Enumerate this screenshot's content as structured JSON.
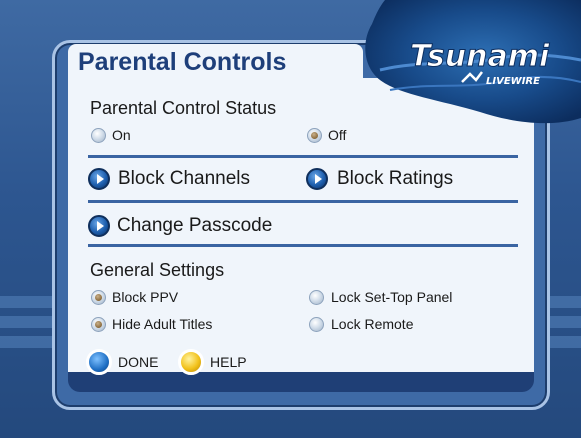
{
  "screen": {
    "title": "Parental Controls",
    "brand": {
      "name": "Tsunami",
      "tagline": "LIVEWIRE"
    }
  },
  "status": {
    "heading": "Parental Control Status",
    "options": [
      {
        "label": "On",
        "selected": false
      },
      {
        "label": "Off",
        "selected": true
      }
    ]
  },
  "actions": {
    "block_channels": "Block Channels",
    "block_ratings": "Block Ratings",
    "change_passcode": "Change Passcode"
  },
  "general": {
    "heading": "General Settings",
    "options": [
      {
        "label": "Block PPV",
        "checked": true
      },
      {
        "label": "Lock Set-Top Panel",
        "checked": false
      },
      {
        "label": "Hide Adult Titles",
        "checked": true
      },
      {
        "label": "Lock Remote",
        "checked": false
      }
    ]
  },
  "footer": {
    "done_label": "DONE",
    "help_label": "HELP"
  },
  "colors": {
    "background": "#2b5288",
    "panel": "#f0f5fb",
    "title": "#1e3f7a",
    "divider": "#3a64a2",
    "done_button": "#1f6fc4",
    "help_button": "#f2c21c"
  }
}
